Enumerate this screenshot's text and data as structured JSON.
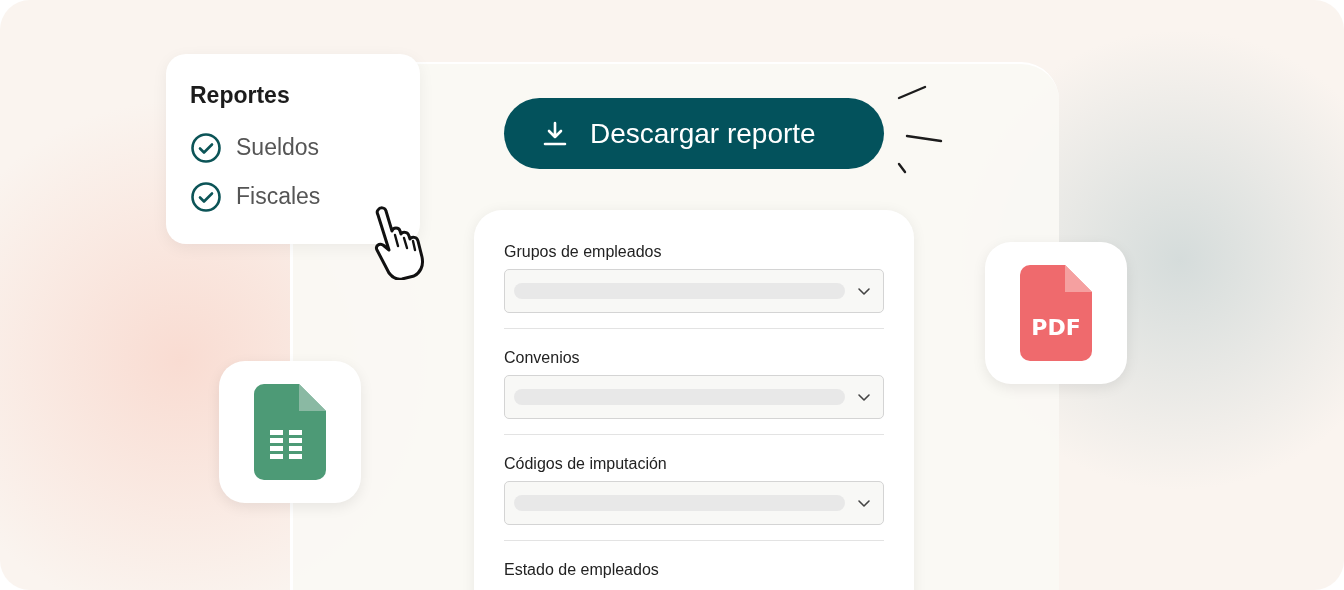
{
  "reports_card": {
    "title": "Reportes",
    "items": [
      {
        "label": "Sueldos",
        "checked": true
      },
      {
        "label": "Fiscales",
        "checked": true
      }
    ]
  },
  "download_button": {
    "label": "Descargar reporte"
  },
  "filters": [
    {
      "label": "Grupos de empleados",
      "kind": "select"
    },
    {
      "label": "Convenios",
      "kind": "select"
    },
    {
      "label": "Códigos de imputación",
      "kind": "select"
    },
    {
      "label": "Estado de empleados",
      "kind": "heading"
    }
  ],
  "pdf_tile": {
    "label": "PDF"
  }
}
